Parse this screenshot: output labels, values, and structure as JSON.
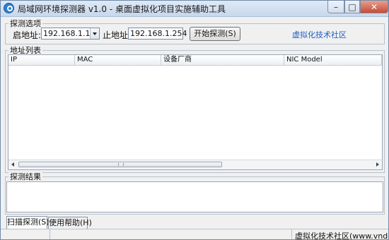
{
  "window": {
    "title": "局域网环境探测器 v1.0 - 桌面虚拟化项目实施辅助工具"
  },
  "probe_options": {
    "group_label": "探测选项",
    "start_label": "启地址:",
    "start_value": "192.168.1.1",
    "end_label": "止地址:",
    "end_value": "192.168.1.254",
    "start_button": "开始探测(S)",
    "community_link": "虚拟化技术社区"
  },
  "address_list": {
    "group_label": "地址列表",
    "columns": [
      "IP",
      "MAC",
      "设备厂商",
      "NIC Model"
    ],
    "rows": []
  },
  "results": {
    "group_label": "探测结果",
    "text": ""
  },
  "tabs": [
    {
      "label": "扫描探测(S)",
      "active": true
    },
    {
      "label": "使用帮助(H)",
      "active": false
    }
  ],
  "statusbar": {
    "text": "虚拟化技术社区(www.vndc"
  },
  "colors": {
    "link": "#1f5fbf",
    "close_button": "#c74a35"
  }
}
